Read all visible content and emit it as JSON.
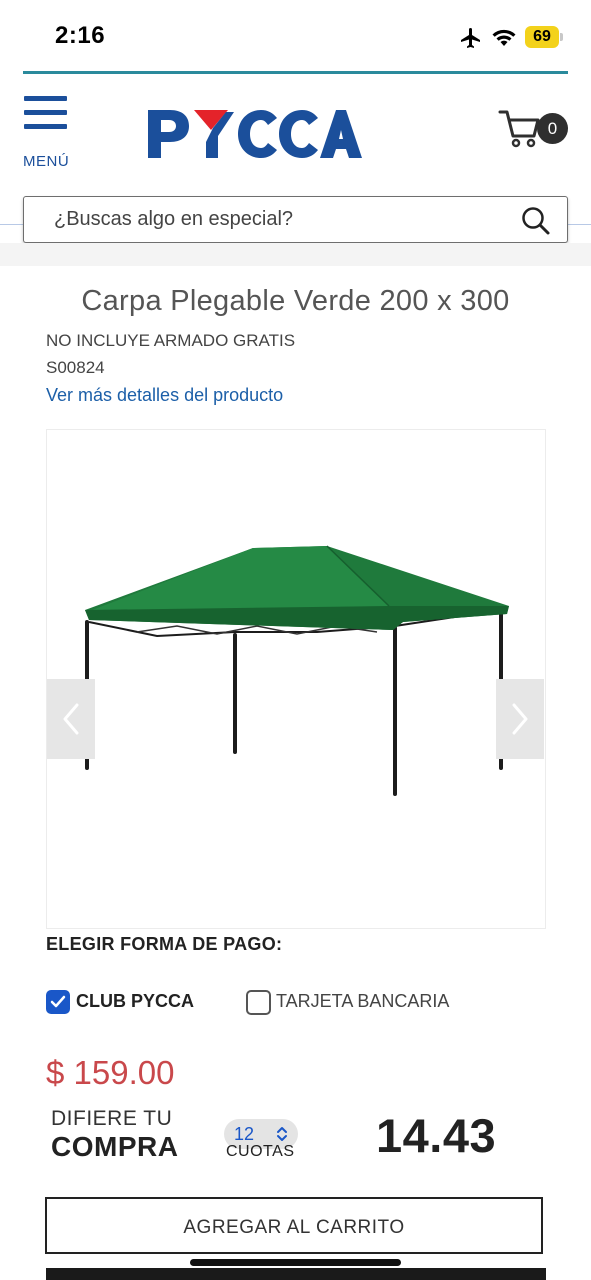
{
  "status_bar": {
    "time": "2:16",
    "battery": "69",
    "icons": [
      "airplane-icon",
      "wifi-icon",
      "battery-icon"
    ]
  },
  "header": {
    "menu_label": "MENÚ",
    "logo_text": "PYCCA",
    "cart_count": "0",
    "brand_color": "#1b4f9b",
    "accent_color": "#e4232a"
  },
  "search": {
    "placeholder": "¿Buscas algo en especial?"
  },
  "product": {
    "title": "Carpa Plegable Verde 200 x 300",
    "note": "NO INCLUYE ARMADO GRATIS",
    "sku": "S00824",
    "details_link": "Ver más detalles del producto",
    "canopy_color": "#1f7a3c"
  },
  "payment": {
    "heading": "ELEGIR FORMA DE PAGO:",
    "options": [
      {
        "label": "CLUB PYCCA",
        "checked": true
      },
      {
        "label": "TARJETA BANCARIA",
        "checked": false
      }
    ],
    "price": "$ 159.00",
    "defer_line1": "DIFIERE TU",
    "defer_line2": "COMPRA",
    "installments_value": "12",
    "installments_label": "CUOTAS",
    "installment_amount": "14.43",
    "add_to_cart": "AGREGAR AL CARRITO"
  }
}
